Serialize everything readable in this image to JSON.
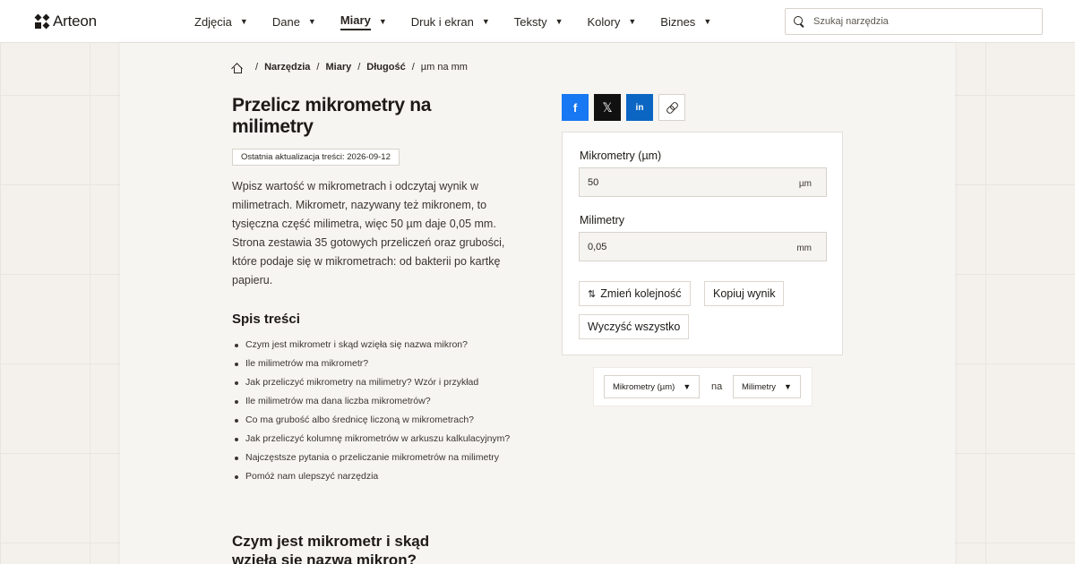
{
  "brand": {
    "name": "Arteon"
  },
  "nav": {
    "items": [
      {
        "label": "Zdjęcia",
        "active": false
      },
      {
        "label": "Dane",
        "active": false
      },
      {
        "label": "Miary",
        "active": true
      },
      {
        "label": "Druk i ekran",
        "active": false
      },
      {
        "label": "Teksty",
        "active": false
      },
      {
        "label": "Kolory",
        "active": false
      },
      {
        "label": "Biznes",
        "active": false
      }
    ],
    "caret": "▼"
  },
  "search": {
    "placeholder": "Szukaj narzędzia"
  },
  "breadcrumb": {
    "items": [
      "Narzędzia",
      "Miary",
      "Długość"
    ],
    "current": "µm na mm",
    "sep": "/"
  },
  "page": {
    "title": "Przelicz mikrometry na milimetry",
    "updated": "Ostatnia aktualizacja treści: 2026-09-12",
    "intro": "Wpisz wartość w mikrometrach i odczytaj wynik w milimetrach. Mikrometr, nazywany też mikronem, to tysięczna część milimetra, więc 50 µm daje 0,05 mm. Strona zestawia 35 gotowych przeliczeń oraz grubości, które podaje się w mikrometrach: od bakterii po kartkę papieru."
  },
  "toc": {
    "title": "Spis treści",
    "items": [
      "Czym jest mikrometr i skąd wzięła się nazwa mikron?",
      "Ile milimetrów ma mikrometr?",
      "Jak przeliczyć mikrometry na milimetry? Wzór i przykład",
      "Ile milimetrów ma dana liczba mikrometrów?",
      "Co ma grubość albo średnicę liczoną w mikrometrach?",
      "Jak przeliczyć kolumnę mikrometrów w arkuszu kalkulacyjnym?",
      "Najczęstsze pytania o przeliczanie mikrometrów na milimetry",
      "Pomóż nam ulepszyć narzędzia"
    ]
  },
  "section": {
    "heading": "Czym jest mikrometr i skąd wzięła się nazwa mikron?"
  },
  "share": {
    "facebook": "f",
    "x": "𝕏",
    "linkedin": "in"
  },
  "converter": {
    "from_label": "Mikrometry (µm)",
    "from_value": "50",
    "from_unit": "µm",
    "to_label": "Milimetry",
    "to_value": "0,05",
    "to_unit": "mm",
    "swap_icon": "⇅",
    "swap_label": "Zmień kolejność",
    "copy_label": "Kopiuj wynik",
    "clear_label": "Wyczyść wszystko"
  },
  "units": {
    "from": "Mikrometry (µm)",
    "connector": "na",
    "to": "Milimetry",
    "caret": "▼"
  }
}
